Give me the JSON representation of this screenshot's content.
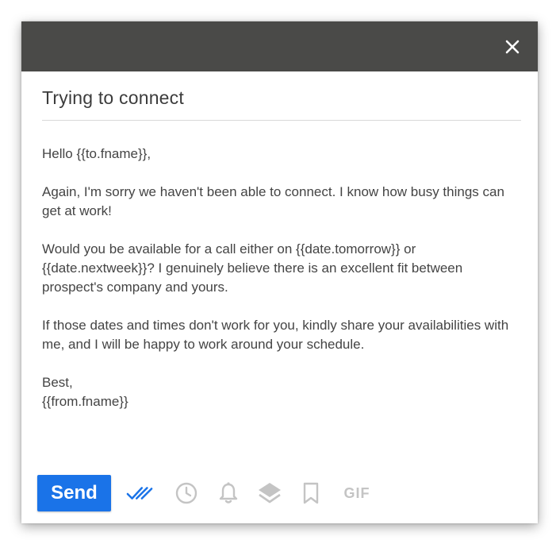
{
  "compose": {
    "subject": "Trying to connect",
    "body": {
      "greeting": "Hello {{to.fname}},",
      "paragraph1": "Again, I'm sorry we haven't been able to connect. I know how busy things can get at work!",
      "paragraph2": "Would you be available for a call either on {{date.tomorrow}} or {{date.nextweek}}? I genuinely believe there is an excellent fit between prospect's company and yours.",
      "paragraph3": "If those dates and times don't work for you, kindly share your availabilities with me, and I will be happy to work around your schedule.",
      "signoff": "Best,",
      "signature": "{{from.fname}}"
    }
  },
  "titlebar": {
    "close_icon": "close-icon"
  },
  "toolbar": {
    "send_label": "Send",
    "gif_label": "GIF",
    "icons": [
      "double-check-icon",
      "clock-icon",
      "bell-icon",
      "layers-icon",
      "bookmark-icon",
      "gif-icon"
    ]
  },
  "colors": {
    "titlebar": "#4a4a48",
    "send_button": "#1a73e8",
    "active_tool": "#1a73e8",
    "inactive_tool": "#c4c4c4",
    "body_text": "#444444"
  }
}
